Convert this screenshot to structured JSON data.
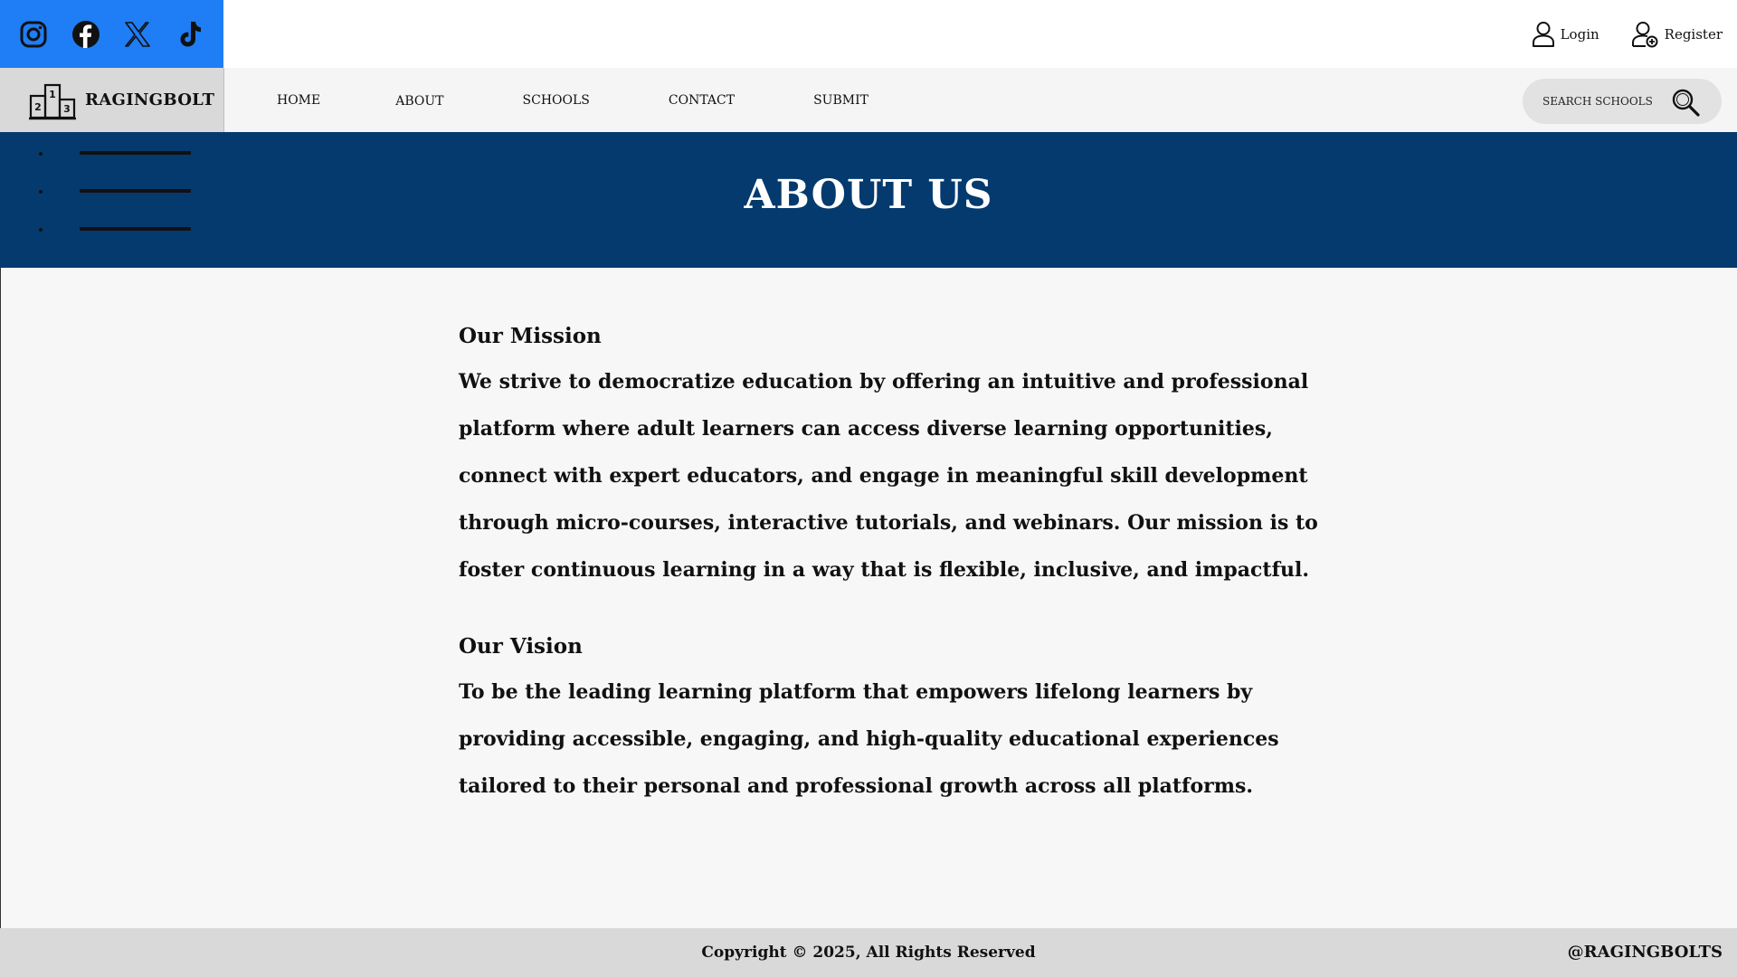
{
  "topbar": {
    "social": [
      {
        "name": "instagram",
        "icon": "instagram-icon"
      },
      {
        "name": "facebook",
        "icon": "facebook-icon"
      },
      {
        "name": "x",
        "icon": "x-icon"
      },
      {
        "name": "tiktok",
        "icon": "tiktok-icon"
      }
    ],
    "login_label": "Login",
    "register_label": "Register"
  },
  "nav": {
    "brand": "RAGINGBOLT",
    "brand_icon": "podium-icon",
    "links": [
      "HOME",
      "ABOUT",
      "SCHOOLS",
      "CONTACT",
      "SUBMIT"
    ],
    "search_placeholder": "SEARCH SCHOOLS",
    "search_icon": "search-icon"
  },
  "hero": {
    "title": "ABOUT US",
    "menu_icon": "hamburger-menu-icon"
  },
  "sections": [
    {
      "title": "Our Mission",
      "body": "We strive to democratize education by offering an intuitive and professional platform where adult learners can access diverse learning opportunities, connect with expert educators, and engage in meaningful skill development through micro-courses, interactive tutorials, and webinars. Our mission is to foster continuous learning in a way that is flexible, inclusive, and impactful."
    },
    {
      "title": "Our Vision",
      "body": "To be the leading learning platform that empowers lifelong learners by providing accessible, engaging, and high-quality educational experiences tailored to their personal and professional growth across all platforms."
    }
  ],
  "footer": {
    "copyright": "Copyright © 2025, All Rights Reserved",
    "handle": "@RAGINGBOLTS"
  },
  "colors": {
    "social_bar": "#1f7df5",
    "hero": "#043a6e",
    "navbar": "#f5f5f5",
    "brand_box": "#d9d9d9",
    "main_bg": "#f7f7f7",
    "footer": "#d9d9d9"
  }
}
